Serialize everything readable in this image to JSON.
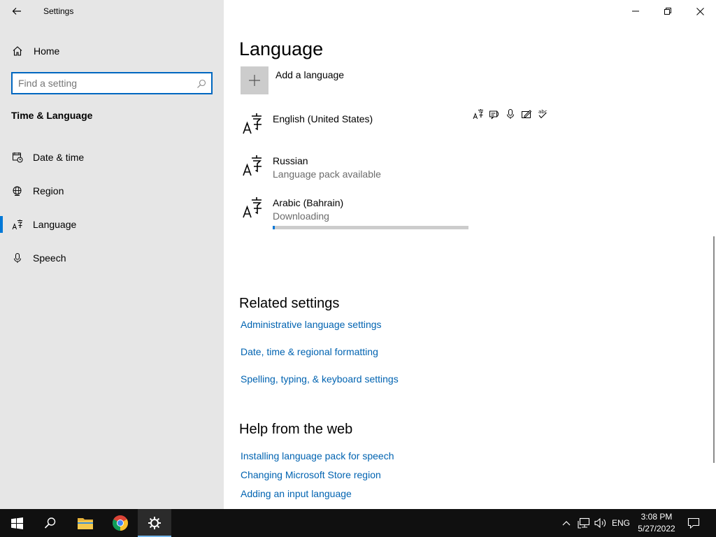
{
  "window": {
    "title": "Settings"
  },
  "sidebar": {
    "home_label": "Home",
    "search_placeholder": "Find a setting",
    "section_heading": "Time & Language",
    "items": [
      {
        "label": "Date & time",
        "icon": "calendar-clock-icon"
      },
      {
        "label": "Region",
        "icon": "globe-icon"
      },
      {
        "label": "Language",
        "icon": "language-icon",
        "active": true
      },
      {
        "label": "Speech",
        "icon": "microphone-icon"
      }
    ]
  },
  "main": {
    "title": "Language",
    "add_language_label": "Add a language",
    "languages": [
      {
        "name": "English (United States)",
        "status": ""
      },
      {
        "name": "Russian",
        "status": "Language pack available"
      },
      {
        "name": "Arabic (Bahrain)",
        "status": "Downloading",
        "progress": 0.01
      }
    ],
    "feature_icons": [
      "display-language-icon",
      "text-to-speech-icon",
      "speech-recognition-icon",
      "handwriting-icon",
      "spelling-icon"
    ],
    "related_heading": "Related settings",
    "related_links": [
      "Administrative language settings",
      "Date, time & regional formatting",
      "Spelling, typing, & keyboard settings"
    ],
    "help_heading": "Help from the web",
    "help_links": [
      "Installing language pack for speech",
      "Changing Microsoft Store region",
      "Adding an input language"
    ]
  },
  "taskbar": {
    "input_language": "ENG",
    "time": "3:08 PM",
    "date": "5/27/2022"
  },
  "colors": {
    "accent": "#0078d7",
    "link": "#0063b1",
    "sidebar_bg": "#e6e6e6",
    "taskbar_bg": "#101010"
  }
}
